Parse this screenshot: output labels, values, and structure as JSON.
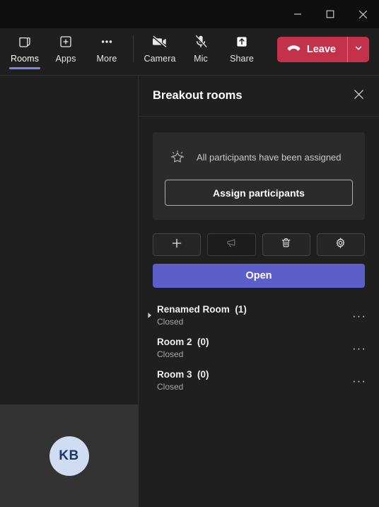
{
  "window": {
    "minimize_label": "Minimize",
    "maximize_label": "Maximize",
    "close_label": "Close"
  },
  "toolbar": {
    "items": [
      {
        "label": "Rooms",
        "icon": "rooms-icon",
        "active": true
      },
      {
        "label": "Apps",
        "icon": "apps-icon",
        "active": false
      },
      {
        "label": "More",
        "icon": "more-icon",
        "active": false
      },
      {
        "label": "Camera",
        "icon": "camera-off-icon",
        "active": false
      },
      {
        "label": "Mic",
        "icon": "mic-off-icon",
        "active": false
      },
      {
        "label": "Share",
        "icon": "share-icon",
        "active": false
      }
    ],
    "leave": {
      "label": "Leave",
      "color": "#c4314b",
      "icon": "hangup-icon",
      "chevron_icon": "chevron-down-icon"
    },
    "active_accent": "#7b83eb"
  },
  "stage": {
    "participant_initials": "KB",
    "avatar_bg": "#cfdcf2",
    "avatar_fg": "#1b3668"
  },
  "panel": {
    "title": "Breakout rooms",
    "close_icon": "close-icon",
    "assign_card": {
      "icon": "sparkle-icon",
      "message": "All participants have been assigned",
      "button_label": "Assign participants"
    },
    "actions": [
      {
        "name": "add-room-button",
        "icon": "plus-icon",
        "glyph": "+",
        "disabled": false
      },
      {
        "name": "announcement-button",
        "icon": "megaphone-icon",
        "glyph": "",
        "disabled": true
      },
      {
        "name": "delete-rooms-button",
        "icon": "trash-icon",
        "glyph": "",
        "disabled": false
      },
      {
        "name": "room-settings-button",
        "icon": "gear-icon",
        "glyph": "",
        "disabled": false
      }
    ],
    "open_button": {
      "label": "Open",
      "color": "#5b5fc7"
    },
    "rooms": [
      {
        "name": "Renamed Room",
        "count": "(1)",
        "state": "Closed",
        "expandable": true
      },
      {
        "name": "Room 2",
        "count": "(0)",
        "state": "Closed",
        "expandable": false
      },
      {
        "name": "Room 3",
        "count": "(0)",
        "state": "Closed",
        "expandable": false
      }
    ],
    "more_glyph": "···"
  }
}
